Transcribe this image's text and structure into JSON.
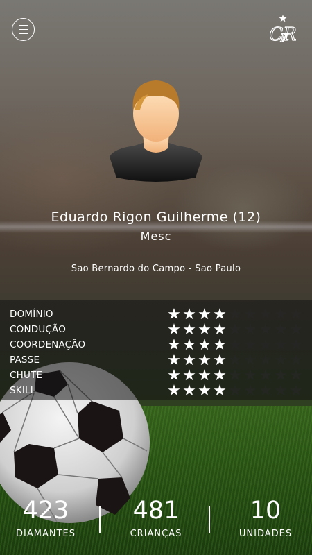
{
  "header": {
    "menu_icon": "hamburger-icon",
    "logo_icon": "crf-crest-icon"
  },
  "profile": {
    "name": "Eduardo Rigon Guilherme (12)",
    "position": "Mesc",
    "location": "Sao Bernardo do Campo - Sao Paulo",
    "avatar_icon": "user-avatar-icon"
  },
  "skills": {
    "max_rating": 9,
    "items": [
      {
        "label": "DOMÍNIO",
        "rating": 4
      },
      {
        "label": "CONDUÇÃO",
        "rating": 4
      },
      {
        "label": "COORDENAÇÃO",
        "rating": 4
      },
      {
        "label": "PASSE",
        "rating": 4
      },
      {
        "label": "CHUTE",
        "rating": 4
      },
      {
        "label": "SKILL",
        "rating": 4
      }
    ]
  },
  "stats": [
    {
      "value": "423",
      "label": "DIAMANTES"
    },
    {
      "value": "481",
      "label": "CRIANÇAS"
    },
    {
      "value": "10",
      "label": "UNIDADES"
    }
  ]
}
